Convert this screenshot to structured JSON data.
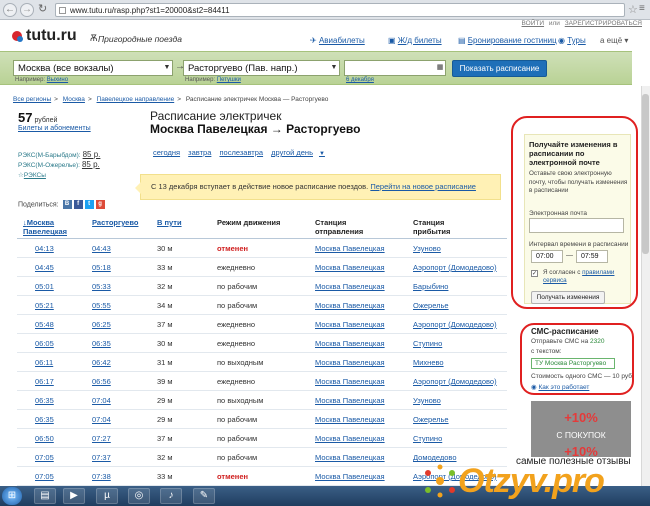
{
  "browser": {
    "url": "www.tutu.ru/rasp.php?st1=20000&st2=84411"
  },
  "header": {
    "logo": "tutu.ru",
    "logo_section": "Пригородные поезда",
    "links": [
      "ВОЙТИ",
      "или",
      "ЗАРЕГИСТРИРОВАТЬСЯ"
    ],
    "nav": [
      "Авиабилеты",
      "Ж/д билеты",
      "Бронирование гостиниц",
      "Туры",
      "а ещё"
    ]
  },
  "search": {
    "from": "Москва (все вокзалы)",
    "to": "Расторгуево (Пав. напр.)",
    "from_hint_label": "Например:",
    "from_hint_link": "Выхино",
    "to_hint_label": "Например:",
    "to_hint_link": "Петушки",
    "date_hint": "6 декабря",
    "submit": "Показать расписание"
  },
  "breadcrumbs": [
    "Все регионы",
    "Москва",
    "Павелецкое направление",
    "Расписание электричек Москва — Расторгуево"
  ],
  "fare": {
    "price": "57",
    "unit": "рублей",
    "link": "Билеты и абонементы",
    "rex1_label": "РЭКС(М-Барыбдом):",
    "rex1_price": "85 р.",
    "rex2_label": "РЭКС(М-Ожерелье):",
    "rex2_price": "85 р.",
    "rex_link": "РЭКСы"
  },
  "share": {
    "label": "Поделиться:"
  },
  "page": {
    "title1": "Расписание электричек",
    "title2": "Москва Павелецкая → Расторгуево",
    "day_tabs": [
      "сегодня",
      "завтра",
      "послезавтра",
      "другой день"
    ]
  },
  "notice": {
    "text": "С 13 декабря вступает в действие новое расписание поездов.",
    "link": "Перейти на новое расписание"
  },
  "table": {
    "headers": {
      "dep": "Москва Павелецкая",
      "arr": "Расторгуево",
      "dur": "В пути",
      "mode": "Режим движения",
      "from": "Станция отправления",
      "to": "Станция прибытия"
    },
    "rows": [
      {
        "dep": "04:13",
        "arr": "04:43",
        "dur": "30 м",
        "mode": "отменен",
        "from": "Москва Павелецкая",
        "to": "Узуново"
      },
      {
        "dep": "04:45",
        "arr": "05:18",
        "dur": "33 м",
        "mode": "ежедневно",
        "from": "Москва Павелецкая",
        "to": "Аэропорт (Домодедово)"
      },
      {
        "dep": "05:01",
        "arr": "05:33",
        "dur": "32 м",
        "mode": "по рабочим",
        "from": "Москва Павелецкая",
        "to": "Барыбино"
      },
      {
        "dep": "05:21",
        "arr": "05:55",
        "dur": "34 м",
        "mode": "по рабочим",
        "from": "Москва Павелецкая",
        "to": "Ожерелье"
      },
      {
        "dep": "05:48",
        "arr": "06:25",
        "dur": "37 м",
        "mode": "ежедневно",
        "from": "Москва Павелецкая",
        "to": "Аэропорт (Домодедово)"
      },
      {
        "dep": "06:05",
        "arr": "06:35",
        "dur": "30 м",
        "mode": "ежедневно",
        "from": "Москва Павелецкая",
        "to": "Ступино"
      },
      {
        "dep": "06:11",
        "arr": "06:42",
        "dur": "31 м",
        "mode": "по выходным",
        "from": "Москва Павелецкая",
        "to": "Михнево"
      },
      {
        "dep": "06:17",
        "arr": "06:56",
        "dur": "39 м",
        "mode": "ежедневно",
        "from": "Москва Павелецкая",
        "to": "Аэропорт (Домодедово)"
      },
      {
        "dep": "06:35",
        "arr": "07:04",
        "dur": "29 м",
        "mode": "по выходным",
        "from": "Москва Павелецкая",
        "to": "Узуново"
      },
      {
        "dep": "06:35",
        "arr": "07:04",
        "dur": "29 м",
        "mode": "по рабочим",
        "from": "Москва Павелецкая",
        "to": "Ожерелье"
      },
      {
        "dep": "06:50",
        "arr": "07:27",
        "dur": "37 м",
        "mode": "по рабочим",
        "from": "Москва Павелецкая",
        "to": "Ступино"
      },
      {
        "dep": "07:05",
        "arr": "07:37",
        "dur": "32 м",
        "mode": "по рабочим",
        "from": "Москва Павелецкая",
        "to": "Домодедово"
      },
      {
        "dep": "07:05",
        "arr": "07:38",
        "dur": "33 м",
        "mode": "отменен",
        "from": "Москва Павелецкая",
        "to": "Аэропорт (Домодедово)"
      }
    ]
  },
  "subscribe": {
    "title": "Получайте изменения в расписании по электронной почте",
    "desc": "Оставьте свою электронную почту, чтобы получать изменения в расписании",
    "email_label": "Электронная почта",
    "interval_label": "Интервал времени в расписании",
    "time_from": "07:00",
    "time_to": "07:59",
    "agree_text": "Я согласен с",
    "agree_link": "правилами сервиса",
    "button": "Получать изменения"
  },
  "sms": {
    "title": "СМС-расписание",
    "line1": "Отправьте СМС на",
    "number": "2320",
    "line2": "с текстом:",
    "code": "ТУ Москва Расторгуево",
    "cost": "Стоимость одного СМС — 10 руб.",
    "how": "Как это работает"
  },
  "ad": {
    "t1": "+10%",
    "t2": "С ПОКУПОК",
    "t3": "+10%"
  },
  "watermark": {
    "text": "самые полезные отзывы",
    "brand": "Otzyv.pro"
  }
}
